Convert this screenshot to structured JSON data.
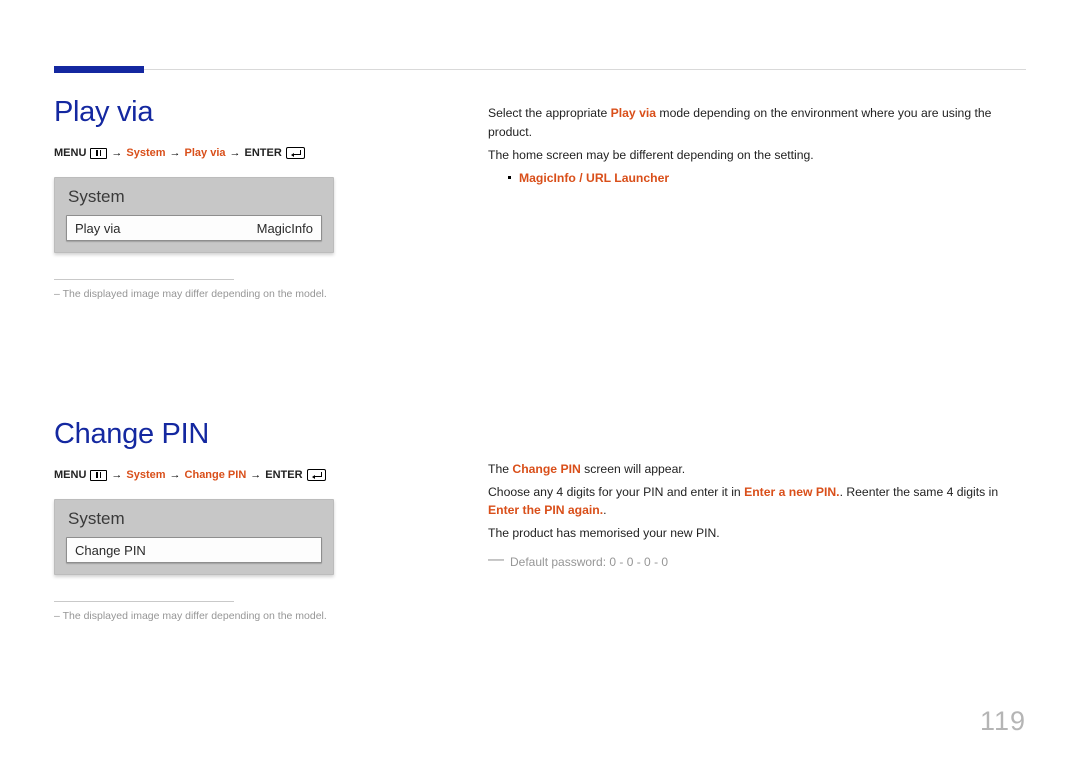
{
  "pageNumber": "119",
  "sections": {
    "playVia": {
      "title": "Play via",
      "path": {
        "menu": "MENU",
        "system": "System",
        "item": "Play via",
        "enter": "ENTER"
      },
      "panel": {
        "title": "System",
        "rowLabel": "Play via",
        "rowValue": "MagicInfo"
      },
      "footnote": "The displayed image may differ depending on the model.",
      "description": {
        "line1_pre": "Select the appropriate ",
        "line1_em": "Play via",
        "line1_post": " mode depending on the environment where you are using the product.",
        "line2": "The home screen may be different depending on the setting.",
        "bullet": "MagicInfo / URL Launcher"
      }
    },
    "changePin": {
      "title": "Change PIN",
      "path": {
        "menu": "MENU",
        "system": "System",
        "item": "Change PIN",
        "enter": "ENTER"
      },
      "panel": {
        "title": "System",
        "rowLabel": "Change PIN"
      },
      "footnote": "The displayed image may differ depending on the model.",
      "description": {
        "line1_pre": "The ",
        "line1_em": "Change PIN",
        "line1_post": " screen will appear.",
        "line2_pre": "Choose any 4 digits for your PIN and enter it in ",
        "line2_em1": "Enter a new PIN.",
        "line2_mid": ". Reenter the same 4 digits in ",
        "line2_em2": "Enter the PIN again.",
        "line2_post": ".",
        "line3": "The product has memorised your new PIN.",
        "defaultNote": "Default password: 0 - 0 - 0 - 0"
      }
    }
  }
}
